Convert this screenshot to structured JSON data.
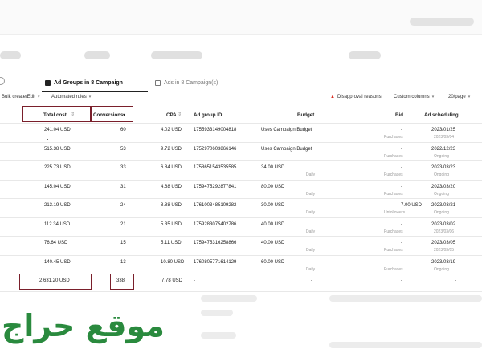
{
  "tabs": [
    {
      "label": "Ad Groups in 8 Campaign",
      "active": true,
      "icon": "folder-filled-icon"
    },
    {
      "label": "Ads in 8 Campaign(s)",
      "active": false,
      "icon": "file-icon"
    }
  ],
  "toolbar": {
    "bulk_label": "Bulk create/Edit",
    "automated_label": "Automated rules",
    "disapproval_label": "Disapproval reasons",
    "custom_columns_label": "Custom columns",
    "page_size_label": "20/page"
  },
  "columns": {
    "total_cost": "Total cost",
    "conversions": "Conversions",
    "cpa": "CPA",
    "ad_group_id": "Ad group ID",
    "budget": "Budget",
    "bid": "Bid",
    "ad_scheduling": "Ad scheduling"
  },
  "rows": [
    {
      "total_cost": "241.04 USD",
      "conversions": "60",
      "cpa": "4.02 USD",
      "ad_group_id": "1755933149004818",
      "budget": "Uses Campaign Budget",
      "budget_sub": "",
      "bid": "-",
      "bid_sub": "Purchases",
      "sched": "2023/01/25",
      "sched_sub": "2023/03/04"
    },
    {
      "total_cost": "515.38 USD",
      "conversions": "53",
      "cpa": "9.72 USD",
      "ad_group_id": "1752970603866146",
      "budget": "Uses Campaign Budget",
      "budget_sub": "",
      "bid": "-",
      "bid_sub": "Purchases",
      "sched": "2022/12/23",
      "sched_sub": "Ongoing"
    },
    {
      "total_cost": "225.73 USD",
      "conversions": "33",
      "cpa": "6.84 USD",
      "ad_group_id": "1758651543535585",
      "budget": "34.00 USD",
      "budget_sub": "Daily",
      "bid": "-",
      "bid_sub": "Purchases",
      "sched": "2023/03/23",
      "sched_sub": "Ongoing"
    },
    {
      "total_cost": "145.04 USD",
      "conversions": "31",
      "cpa": "4.68 USD",
      "ad_group_id": "1759475292877841",
      "budget": "80.00 USD",
      "budget_sub": "Daily",
      "bid": "-",
      "bid_sub": "Purchases",
      "sched": "2023/03/20",
      "sched_sub": "Ongoing"
    },
    {
      "total_cost": "213.19 USD",
      "conversions": "24",
      "cpa": "8.88 USD",
      "ad_group_id": "1761003485109282",
      "budget": "30.00 USD",
      "budget_sub": "Daily",
      "bid": "7.00 USD",
      "bid_sub": "Unfollowers",
      "sched": "2023/03/21",
      "sched_sub": "Ongoing"
    },
    {
      "total_cost": "112.34 USD",
      "conversions": "21",
      "cpa": "5.35 USD",
      "ad_group_id": "1759283075402786",
      "budget": "40.00 USD",
      "budget_sub": "Daily",
      "bid": "-",
      "bid_sub": "Purchases",
      "sched": "2023/03/02",
      "sched_sub": "2023/03/06"
    },
    {
      "total_cost": "76.64 USD",
      "conversions": "15",
      "cpa": "5.11 USD",
      "ad_group_id": "1759475316258866",
      "budget": "40.00 USD",
      "budget_sub": "Daily",
      "bid": "-",
      "bid_sub": "Purchases",
      "sched": "2023/03/05",
      "sched_sub": "2023/03/05"
    },
    {
      "total_cost": "140.45 USD",
      "conversions": "13",
      "cpa": "10.80 USD",
      "ad_group_id": "1760805771614129",
      "budget": "60.00 USD",
      "budget_sub": "Daily",
      "bid": "-",
      "bid_sub": "Purchases",
      "sched": "2023/03/19",
      "sched_sub": "Ongoing"
    }
  ],
  "totals": {
    "total_cost": "2,631.20 USD",
    "conversions": "338",
    "cpa": "7.78 USD",
    "ad_group_id": "-",
    "budget": "-",
    "bid": "-",
    "sched": "-"
  },
  "watermark": "موقع حراج",
  "colors": {
    "highlight": "#7a1f2b",
    "watermark": "#2a8a3e",
    "warning": "#d93025"
  }
}
